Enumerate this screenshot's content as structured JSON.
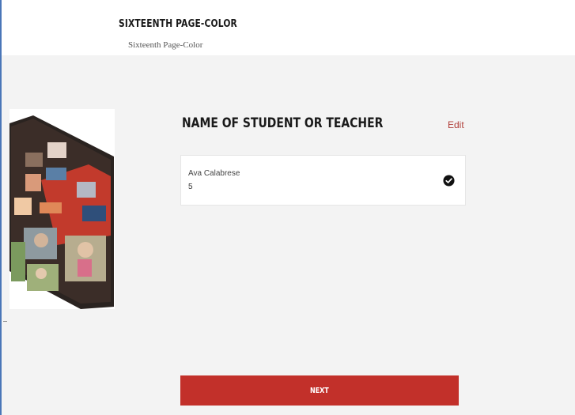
{
  "header": {
    "title": "SIXTEENTH PAGE-COLOR",
    "subtitle": "Sixteenth Page-Color"
  },
  "section": {
    "title": "NAME OF STUDENT OR TEACHER",
    "edit_label": "Edit"
  },
  "entry": {
    "name": "Ava Calabrese",
    "value": "5",
    "status_icon": "check-circle-icon"
  },
  "actions": {
    "next_label": "NEXT"
  },
  "colors": {
    "accent": "#c2302a",
    "edit_link": "#b1403b"
  }
}
